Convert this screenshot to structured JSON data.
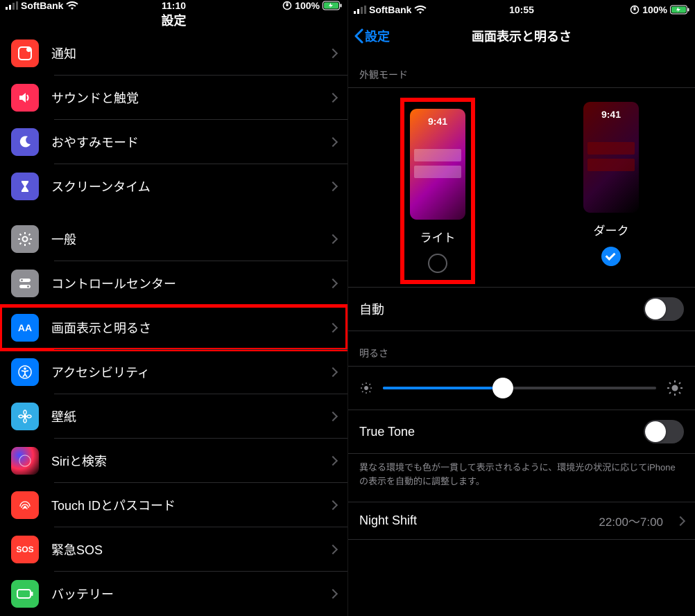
{
  "left": {
    "status": {
      "carrier": "SoftBank",
      "time": "11:10",
      "battery": "100%"
    },
    "title": "設定",
    "group1": [
      {
        "label": "通知"
      },
      {
        "label": "サウンドと触覚"
      },
      {
        "label": "おやすみモード"
      },
      {
        "label": "スクリーンタイム"
      }
    ],
    "group2": [
      {
        "label": "一般"
      },
      {
        "label": "コントロールセンター"
      },
      {
        "label": "画面表示と明るさ"
      },
      {
        "label": "アクセシビリティ"
      },
      {
        "label": "壁紙"
      },
      {
        "label": "Siriと検索"
      },
      {
        "label": "Touch IDとパスコード"
      },
      {
        "label": "緊急SOS"
      },
      {
        "label": "バッテリー"
      }
    ]
  },
  "right": {
    "status": {
      "carrier": "SoftBank",
      "time": "10:55",
      "battery": "100%"
    },
    "back": "設定",
    "title": "画面表示と明るさ",
    "appearance_header": "外観モード",
    "preview_time": "9:41",
    "light_label": "ライト",
    "dark_label": "ダーク",
    "auto_label": "自動",
    "brightness_header": "明るさ",
    "truetone_label": "True Tone",
    "truetone_note": "異なる環境でも色が一貫して表示されるように、環境光の状況に応じてiPhoneの表示を自動的に調整します。",
    "nightshift_label": "Night Shift",
    "nightshift_value": "22:00〜7:00"
  }
}
